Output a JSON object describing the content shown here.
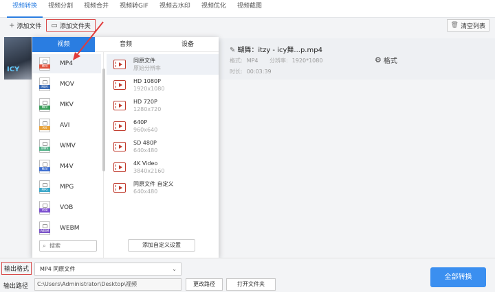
{
  "top_tabs": [
    "视频转换",
    "视频分割",
    "视频合并",
    "视频转GIF",
    "视频去水印",
    "视频优化",
    "视频截图"
  ],
  "toolbar": {
    "add_file": "添加文件",
    "add_folder": "添加文件夹",
    "clear_list": "清空列表"
  },
  "thumbnail_text": "ICY",
  "file": {
    "name": "蝴舞：itzy - icy舞...p.mp4",
    "format_label": "格式:",
    "format_value": "MP4",
    "resolution_label": "分辨率:",
    "resolution_value": "1920*1080",
    "duration_label": "时长:",
    "duration_value": "00:03:39",
    "settings_label": "格式"
  },
  "popup": {
    "tabs": [
      "视频",
      "音频",
      "设备"
    ],
    "active_tab": "视频",
    "formats": [
      {
        "label": "MP4",
        "color": "#e0533d"
      },
      {
        "label": "MOV",
        "color": "#3b6cb6"
      },
      {
        "label": "MKV",
        "color": "#3a9e5a"
      },
      {
        "label": "AVI",
        "color": "#e8a23a"
      },
      {
        "label": "WMV",
        "color": "#56b38a"
      },
      {
        "label": "M4V",
        "color": "#3f6fd1"
      },
      {
        "label": "MPG",
        "color": "#3aa7c9"
      },
      {
        "label": "VOB",
        "color": "#7c4fd0"
      },
      {
        "label": "WEBM",
        "color": "#7d55c9"
      }
    ],
    "selected_format": "MP4",
    "resolutions": [
      {
        "name": "同原文件",
        "sub": "原始分辨率"
      },
      {
        "name": "HD 1080P",
        "sub": "1920x1080"
      },
      {
        "name": "HD 720P",
        "sub": "1280x720"
      },
      {
        "name": "640P",
        "sub": "960x640"
      },
      {
        "name": "SD 480P",
        "sub": "640x480"
      },
      {
        "name": "4K Video",
        "sub": "3840x2160"
      },
      {
        "name": "同原文件 自定义",
        "sub": "640x480"
      }
    ],
    "search_placeholder": "搜索",
    "add_custom": "添加自定义设置"
  },
  "bottom": {
    "output_format_label": "输出格式",
    "output_format_value": "MP4  同原文件",
    "output_path_label": "输出路径",
    "output_path_value": "C:\\Users\\Administrator\\Desktop\\视频",
    "change_path": "更改路径",
    "open_folder": "打开文件夹",
    "convert_all": "全部转换"
  },
  "colors": {
    "accent": "#2a7de1",
    "convert_button": "#3b8ff0",
    "highlight_box": "#d84a4a"
  }
}
